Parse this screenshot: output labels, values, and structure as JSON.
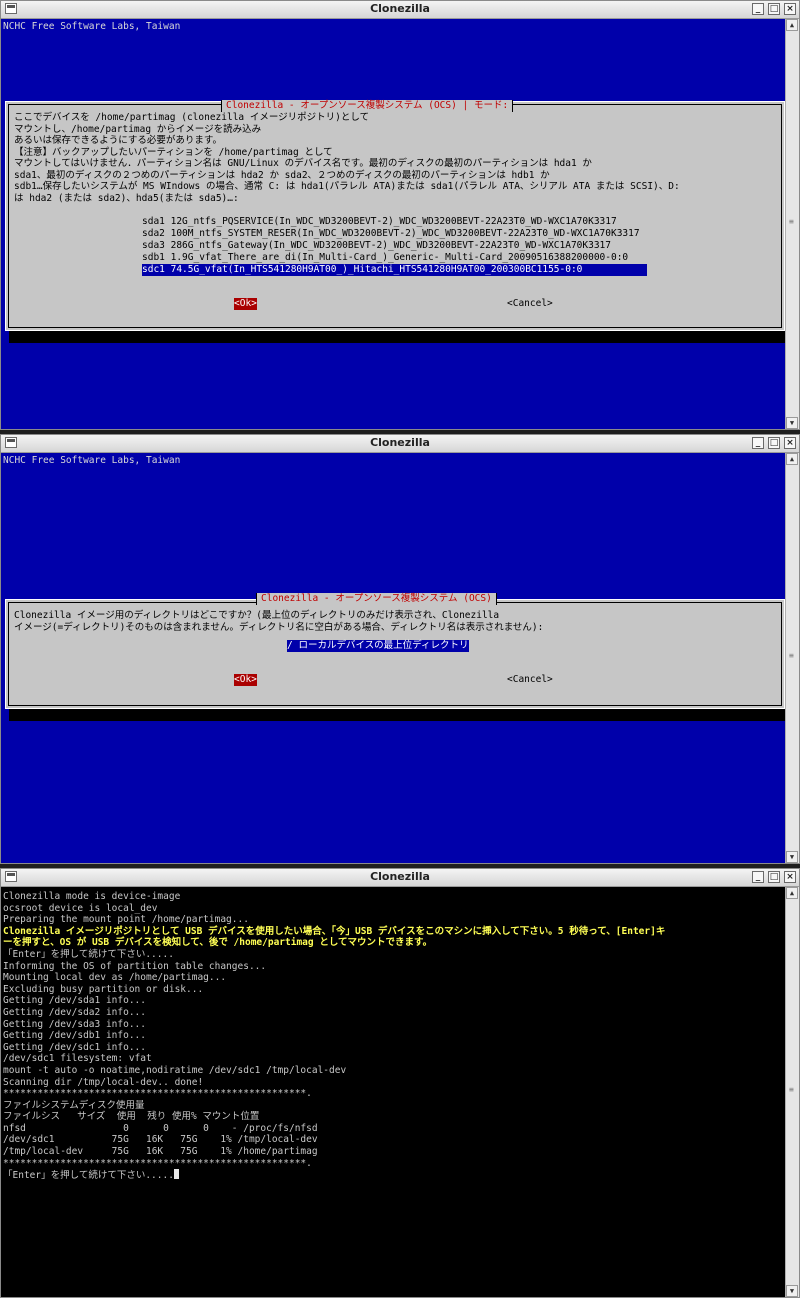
{
  "window_title": "Clonezilla",
  "window1": {
    "org": "NCHC Free Software Labs, Taiwan",
    "dialog_title": "Clonezilla - オープンソース複製システム (OCS) | モード:",
    "text": [
      "ここでデバイスを /home/partimag (clonezilla イメージリポジトリ)として",
      "マウントし、/home/partimag からイメージを読み込み",
      "あるいは保存できるようにする必要があります。",
      "【注意】バックアップしたいパーティションを /home/partimag として",
      "マウントしてはいけません．パーティション名は GNU/Linux のデバイス名です。最初のディスクの最初のパーティションは hda1 か",
      "sda1、最初のディスクの２つめのパーティションは hda2 か sda2、２つめのディスクの最初のパーティションは hdb1 か",
      "sdb1…保存したいシステムが MS WIndows の場合、通常 C: は hda1(パラレル ATA)または sda1(パラレル ATA、シリアル ATA または SCSI)、D:",
      "は hda2 (または sda2)、hda5(または sda5)…:"
    ],
    "options": [
      "sda1 12G_ntfs_PQSERVICE(In_WDC_WD3200BEVT-2)_WDC_WD3200BEVT-22A23T0_WD-WXC1A70K3317",
      "sda2 100M_ntfs_SYSTEM_RESER(In_WDC_WD3200BEVT-2)_WDC_WD3200BEVT-22A23T0_WD-WXC1A70K3317",
      "sda3 286G_ntfs_Gateway(In_WDC_WD3200BEVT-2)_WDC_WD3200BEVT-22A23T0_WD-WXC1A70K3317",
      "sdb1 1.9G_vfat_There_are_di(In_Multi-Card_)_Generic-_Multi-Card_20090516388200000-0:0",
      "sdc1 74.5G_vfat(In_HTS541280H9AT00_)_Hitachi_HTS541280H9AT00_200300BC1155-0:0"
    ],
    "selected_index": 4,
    "ok_label": "<Ok>",
    "cancel_label": "<Cancel>"
  },
  "window2": {
    "org": "NCHC Free Software Labs, Taiwan",
    "dialog_title": "Clonezilla - オープンソース複製システム (OCS)",
    "text": [
      "Clonezilla イメージ用のディレクトリはどこですか？(最上位のディレクトリのみだけ表示され、Clonezilla",
      "イメージ(=ディレクトリ)そのものは含まれません。ディレクトリ名に空白がある場合、ディレクトリ名は表示されません):"
    ],
    "option": "/ ローカルデバイスの最上位ディレクトリ",
    "ok_label": "<Ok>",
    "cancel_label": "<Cancel>"
  },
  "window3": {
    "lines_before": [
      "Clonezilla mode is device-image",
      "ocsroot device is local_dev",
      "Preparing the mount point /home/partimag..."
    ],
    "highlight": [
      "Clonezilla イメージリポジトリとして USB デバイスを使用したい場合、「今」USB デバイスをこのマシンに挿入して下さい。5 秒待って、[Enter]キ",
      "ーを押すと、OS が USB デバイスを検知して、後で /home/partimag としてマウントできます。"
    ],
    "lines_after": [
      "「Enter」を押して続けて下さい.....",
      "Informing the OS of partition table changes...",
      "Mounting local dev as /home/partimag...",
      "Excluding busy partition or disk...",
      "Getting /dev/sda1 info...",
      "Getting /dev/sda2 info...",
      "Getting /dev/sda3 info...",
      "Getting /dev/sdb1 info...",
      "Getting /dev/sdc1 info...",
      "/dev/sdc1 filesystem: vfat",
      "mount -t auto -o noatime,nodiratime /dev/sdc1 /tmp/local-dev",
      "Scanning dir /tmp/local-dev.. done!",
      "*****************************************************.",
      "ファイルシステムディスク使用量",
      "ファイルシス   サイズ  使用  残り 使用% マウント位置",
      "nfsd                 0      0      0    - /proc/fs/nfsd",
      "/dev/sdc1          75G   16K   75G    1% /tmp/local-dev",
      "/tmp/local-dev     75G   16K   75G    1% /home/partimag",
      "*****************************************************."
    ],
    "prompt": "「Enter」を押して続けて下さい....."
  }
}
